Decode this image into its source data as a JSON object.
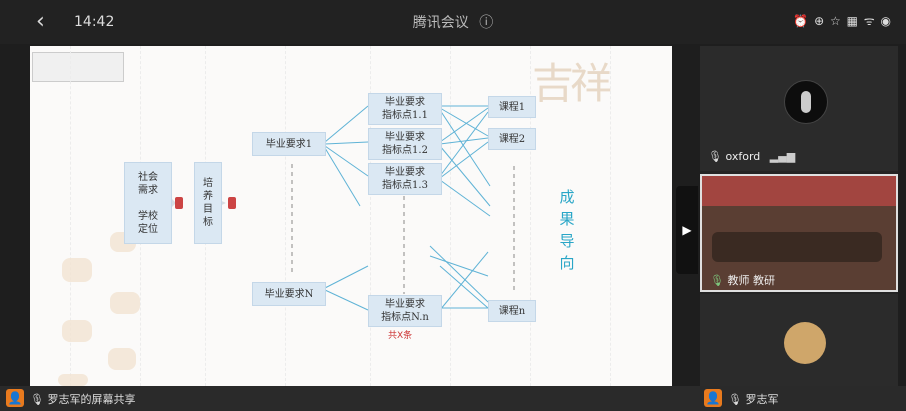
{
  "status_bar": {
    "time": "14:42",
    "icons": "⏰ ⊕ ☆ ▦ ᯤ ◉"
  },
  "window": {
    "title": "腾讯会议",
    "info_icon": "ⓘ",
    "back_icon": "‹"
  },
  "share": {
    "diagram": {
      "left_box": "社会\n需求\n\n学校\n定位",
      "middle_box": "培\n养\n目\n标",
      "req1": "毕业要求1",
      "reqN": "毕业要求N",
      "ind11": "毕业要求\n指标点1.1",
      "ind12": "毕业要求\n指标点1.2",
      "ind13": "毕业要求\n指标点1.3",
      "indNn": "毕业要求\n指标点N.n",
      "course1": "课程1",
      "course2": "课程2",
      "coursen": "课程n",
      "vertical_text": "成\n果\n导\n向",
      "red_label": "共X条"
    }
  },
  "footer": {
    "sharer": "罗志军的屏幕共享",
    "participant3": "罗志军"
  },
  "participants": {
    "p1": "oxford",
    "p2": "教师 教研"
  },
  "colors": {
    "accent_orange": "#e87a1e",
    "diagram_cyan": "#29a6c7",
    "node_fill": "#dbe8f3"
  }
}
